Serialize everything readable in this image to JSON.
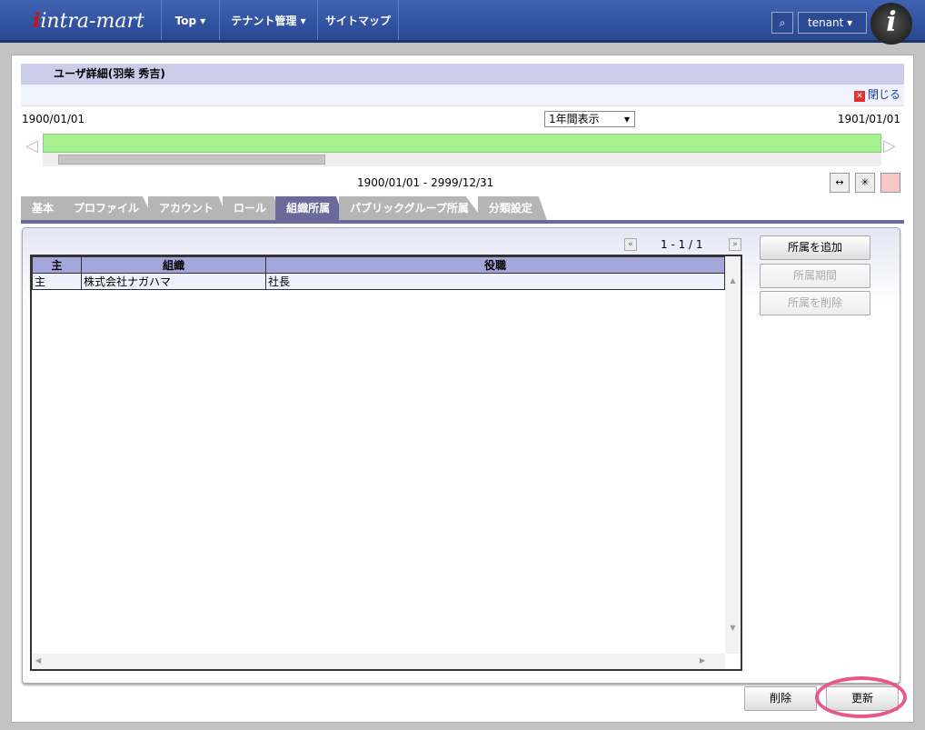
{
  "header": {
    "logo": "intra-mart",
    "nav": [
      "Top ▾",
      "テナント管理 ▾",
      "サイトマップ"
    ],
    "search_icon": "search-icon",
    "user": "tenant",
    "avatar": "i"
  },
  "page": {
    "title": "ユーザ詳細(羽柴 秀吉)",
    "close": "閉じる"
  },
  "timeline": {
    "start": "1900/01/01",
    "end": "1901/01/01",
    "view_select": "1年間表示",
    "range": "1900/01/01 - 2999/12/31",
    "bar_color": "#a6f08f"
  },
  "tabs": [
    "基本",
    "プロファイル",
    "アカウント",
    "ロール",
    "組織所属",
    "パブリックグループ所属",
    "分類設定"
  ],
  "active_tab": 4,
  "pager": {
    "prev": "«",
    "text": "1 - 1 / 1",
    "next": "»"
  },
  "table": {
    "headers": [
      "主",
      "組織",
      "役職"
    ],
    "rows": [
      [
        "主",
        "株式会社ナガハマ",
        "社長"
      ]
    ]
  },
  "side_buttons": {
    "add": "所属を追加",
    "period": "所属期間",
    "remove": "所属を削除"
  },
  "footer": {
    "delete": "削除",
    "update": "更新"
  }
}
